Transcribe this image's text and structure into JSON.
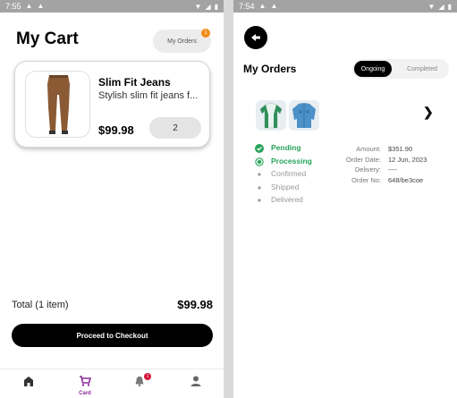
{
  "left": {
    "status": {
      "time": "7:55"
    },
    "title": "My Cart",
    "my_orders_label": "My Orders",
    "orders_badge": "1",
    "item": {
      "name": "Slim Fit Jeans",
      "description": "Stylish slim fit jeans f...",
      "price": "$99.98",
      "quantity": "2"
    },
    "total_label": "Total (1 item)",
    "total_value": "$99.98",
    "checkout_label": "Proceed to Checkout",
    "nav": {
      "items": [
        {
          "icon": "home-icon",
          "label": ""
        },
        {
          "icon": "cart-icon",
          "label": "Card"
        },
        {
          "icon": "bell-icon",
          "label": ""
        },
        {
          "icon": "profile-icon",
          "label": ""
        }
      ],
      "bell_badge": "1",
      "active_color": "#8a2a9a"
    }
  },
  "right": {
    "status": {
      "time": "7:54"
    },
    "title": "My Orders",
    "tabs": {
      "active": "Ongoing",
      "inactive": "Completed"
    },
    "steps": [
      {
        "label": "Pending",
        "state": "done"
      },
      {
        "label": "Processing",
        "state": "current"
      },
      {
        "label": "Confirmed",
        "state": "todo"
      },
      {
        "label": "Shipped",
        "state": "todo"
      },
      {
        "label": "Delivered",
        "state": "todo"
      }
    ],
    "info": [
      {
        "key": "Amount:",
        "value": "$351.90"
      },
      {
        "key": "Order Date:",
        "value": "12 Jun, 2023"
      },
      {
        "key": "Delivery:",
        "value": "----"
      },
      {
        "key": "Order No:",
        "value": "648/be3coe"
      }
    ],
    "accent": "#27a35a"
  }
}
